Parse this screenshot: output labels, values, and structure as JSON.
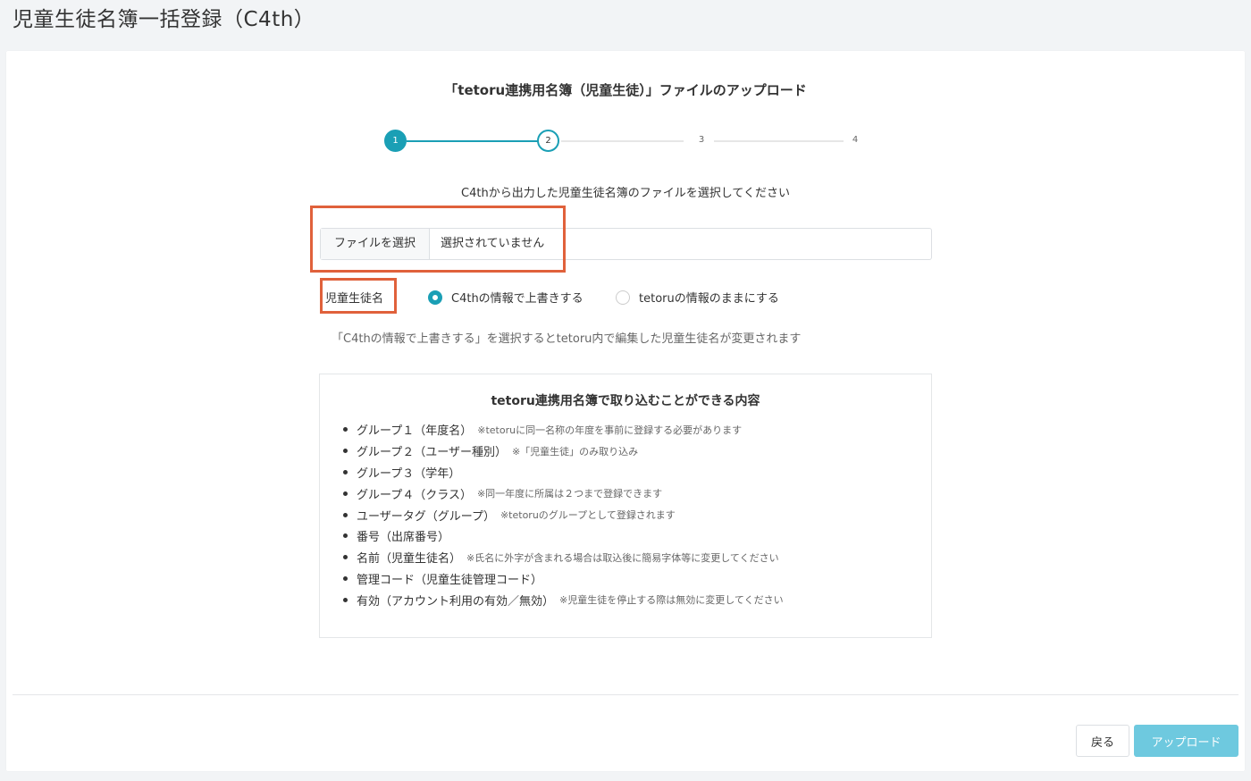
{
  "header": {
    "title": "児童生徒名簿一括登録（C4th）"
  },
  "upload": {
    "title": "「tetoru連携用名簿（児童生徒）」ファイルのアップロード",
    "steps": [
      "1",
      "2",
      "3",
      "4"
    ],
    "instruction": "C4thから出力した児童生徒名簿のファイルを選択してください",
    "file_button": "ファイルを選択",
    "file_status": "選択されていません"
  },
  "name_option": {
    "label": "児童生徒名",
    "options": [
      "C4thの情報で上書きする",
      "tetoruの情報のままにする"
    ],
    "selected": "C4thの情報で上書きする",
    "note": "「C4thの情報で上書きする」を選択するとtetoru内で編集した児童生徒名が変更されます"
  },
  "info": {
    "title": "tetoru連携用名簿で取り込むことができる内容",
    "items": [
      {
        "text": "グループ１（年度名）",
        "note": "※tetoruに同一名称の年度を事前に登録する必要があります"
      },
      {
        "text": "グループ２（ユーザー種別）",
        "note": "※「児童生徒」のみ取り込み"
      },
      {
        "text": "グループ３（学年）",
        "note": ""
      },
      {
        "text": "グループ４（クラス）",
        "note": "※同一年度に所属は２つまで登録できます"
      },
      {
        "text": "ユーザータグ（グループ）",
        "note": "※tetoruのグループとして登録されます"
      },
      {
        "text": "番号（出席番号）",
        "note": ""
      },
      {
        "text": "名前（児童生徒名）",
        "note": "※氏名に外字が含まれる場合は取込後に簡易字体等に変更してください"
      },
      {
        "text": "管理コード（児童生徒管理コード）",
        "note": ""
      },
      {
        "text": "有効（アカウント利用の有効／無効）",
        "note": "※児童生徒を停止する際は無効に変更してください"
      }
    ]
  },
  "footer": {
    "back": "戻る",
    "upload": "アップロード"
  },
  "colors": {
    "accent": "#1a9fb5",
    "upload_button": "#6ec9df",
    "highlight": "#e0613b"
  }
}
